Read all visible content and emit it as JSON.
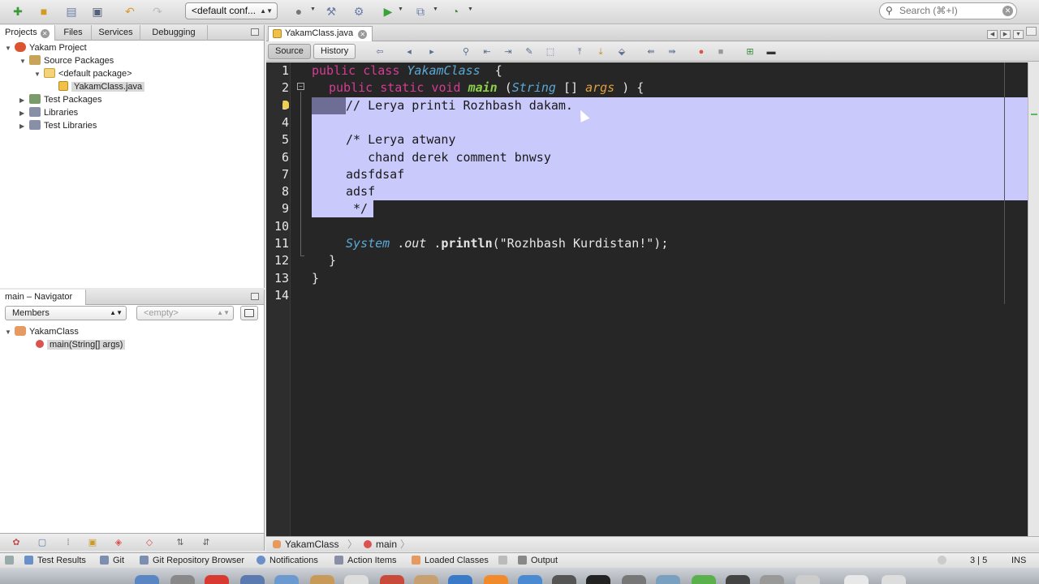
{
  "toolbar": {
    "config_select": "<default conf...",
    "search_placeholder": "Search (⌘+I)"
  },
  "projects_panel": {
    "tabs": [
      "Projects",
      "Files",
      "Services",
      "Debugging"
    ],
    "tree": [
      {
        "label": "Yakam Project"
      },
      {
        "label": "Source Packages"
      },
      {
        "label": "<default package>"
      },
      {
        "label": "YakamClass.java"
      },
      {
        "label": "Test Packages"
      },
      {
        "label": "Libraries"
      },
      {
        "label": "Test Libraries"
      }
    ]
  },
  "navigator": {
    "title": "main – Navigator",
    "filter_select": "Members",
    "empty_select": "<empty>",
    "tree": [
      {
        "label": "YakamClass"
      },
      {
        "label": "main(String[] args)"
      }
    ]
  },
  "editor": {
    "tab": "YakamClass.java",
    "source_button": "Source",
    "history_button": "History",
    "line_numbers": [
      "1",
      "2",
      "3",
      "4",
      "5",
      "6",
      "7",
      "8",
      "9",
      "10",
      "11",
      "12",
      "13",
      "14"
    ],
    "code": {
      "l1_kw": "public class ",
      "l1_cls": "YakamClass",
      "l1_rest": "  {",
      "l2_kw": "public static void ",
      "l2_mth": "main",
      "l2_p1": " (",
      "l2_cls": "String",
      "l2_p2": " [] ",
      "l2_arg": "args",
      "l2_p3": " ) {",
      "l3": "// Lerya printi Rozhbash dakam.",
      "l5": "/* Lerya atwany",
      "l6": "   chand derek comment bnwsy",
      "l7": "adsfdsaf",
      "l8": "adsf",
      "l9": " */",
      "l11_cls": "System",
      "l11_p1": " .",
      "l11_out": "out",
      "l11_p2": " .",
      "l11_mth": "println",
      "l11_str": "(\"Rozhbash Kurdistan!\");",
      "l12": "}",
      "l13": "}"
    }
  },
  "breadcrumb": [
    "YakamClass",
    "main"
  ],
  "statusbar": {
    "items": [
      "Test Results",
      "Git",
      "Git Repository Browser",
      "Notifications",
      "Action Items",
      "Loaded Classes",
      "Output"
    ],
    "position": "3 | 5",
    "mode": "INS"
  },
  "colors": {
    "selection": "#c9c9fb",
    "keyword": "#d53c93",
    "class": "#5aa8d6",
    "method": "#8dd14a",
    "argument": "#e0a040",
    "editor_bg": "#262626"
  }
}
